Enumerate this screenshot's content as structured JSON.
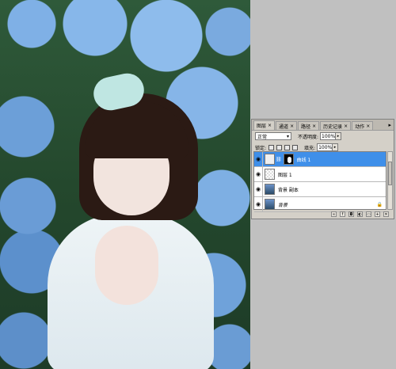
{
  "panel": {
    "tabs": [
      {
        "label": "图层",
        "active": true
      },
      {
        "label": "通道",
        "active": false
      },
      {
        "label": "路径",
        "active": false
      },
      {
        "label": "历史记录",
        "active": false
      },
      {
        "label": "动作",
        "active": false
      }
    ],
    "close_glyph": "×",
    "menu_glyph": "▸",
    "blend_mode": "正常",
    "opacity_label": "不透明度:",
    "opacity_value": "100%",
    "lock_label": "锁定:",
    "fill_label": "填充:",
    "fill_value": "100%",
    "layers": [
      {
        "name": "曲线 1",
        "thumb": "curve",
        "has_mask": true,
        "selected": true,
        "visible": true
      },
      {
        "name": "图层 1",
        "thumb": "empty",
        "has_mask": false,
        "selected": false,
        "visible": true
      },
      {
        "name": "背景 副本",
        "thumb": "photo",
        "has_mask": false,
        "selected": false,
        "visible": true
      },
      {
        "name": "背景",
        "thumb": "photo",
        "has_mask": false,
        "selected": false,
        "visible": true,
        "locked": true
      }
    ],
    "footer_buttons": [
      "link-icon",
      "fx-icon",
      "mask-icon",
      "adjustment-icon",
      "folder-icon",
      "new-layer-icon",
      "trash-icon"
    ],
    "colors": {
      "selected_layer": "#3f8fe9",
      "panel_bg": "#d4d0c8",
      "workspace_bg": "#c0c0c0"
    }
  }
}
